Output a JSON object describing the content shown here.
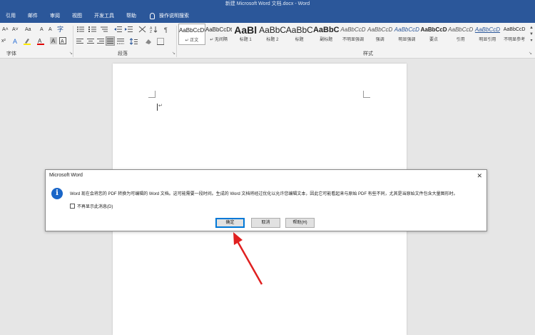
{
  "window": {
    "title": "新建 Microsoft Word 文档.docx  -  Word"
  },
  "tabs": [
    "引用",
    "邮件",
    "审阅",
    "视图",
    "开发工具",
    "帮助"
  ],
  "tell_me": "操作说明搜索",
  "ribbon": {
    "font_group_label": "字体",
    "paragraph_group_label": "段落",
    "styles_group_label": "样式",
    "font_buttons": {
      "grow": "A˄",
      "shrink": "A˅",
      "case": "Aa",
      "clear": "A",
      "phonetic": "A",
      "superscript": "x²",
      "font_color": "A",
      "highlight": "ab",
      "char_shade": "A",
      "enclose": "字"
    },
    "styles": [
      {
        "sample": "AaBbCcDt",
        "name": "↵ 正文",
        "selected": true
      },
      {
        "sample": "AaBbCcDt",
        "name": "↵ 无间隔"
      },
      {
        "sample": "AaBl",
        "name": "标题 1"
      },
      {
        "sample": "AaBbC",
        "name": "标题 2"
      },
      {
        "sample": "AaBbC",
        "name": "标题"
      },
      {
        "sample": "AaBbC",
        "name": "副标题"
      },
      {
        "sample": "AaBbCcD",
        "name": "不明显强调"
      },
      {
        "sample": "AaBbCcD",
        "name": "强调"
      },
      {
        "sample": "AaBbCcD",
        "name": "明显强调"
      },
      {
        "sample": "AaBbCcD",
        "name": "要点"
      },
      {
        "sample": "AaBbCcD",
        "name": "引用"
      },
      {
        "sample": "AaBbCcD",
        "name": "明显引用"
      },
      {
        "sample": "AaBbCcD",
        "name": "不明显参考"
      }
    ]
  },
  "document": {
    "paragraph_mark": "↵"
  },
  "dialog": {
    "title": "Microsoft Word",
    "close": "✕",
    "icon": "i",
    "message": "Word 现在会将您的 PDF 转换为可编辑的 Word 文档。这可能需要一段时间。生成的 Word 文档将经过优化以允许您编辑文本，因此它可能看起来与原始 PDF 有些不同，尤其是当原始文件包含大量图形时。",
    "checkbox_label": "不再显示此消息(D)",
    "buttons": {
      "ok": "确定",
      "cancel": "取消",
      "help": "帮助(H)"
    }
  },
  "colors": {
    "accent": "#2b579a",
    "arrow": "#e02020",
    "info": "#1a66c8"
  }
}
